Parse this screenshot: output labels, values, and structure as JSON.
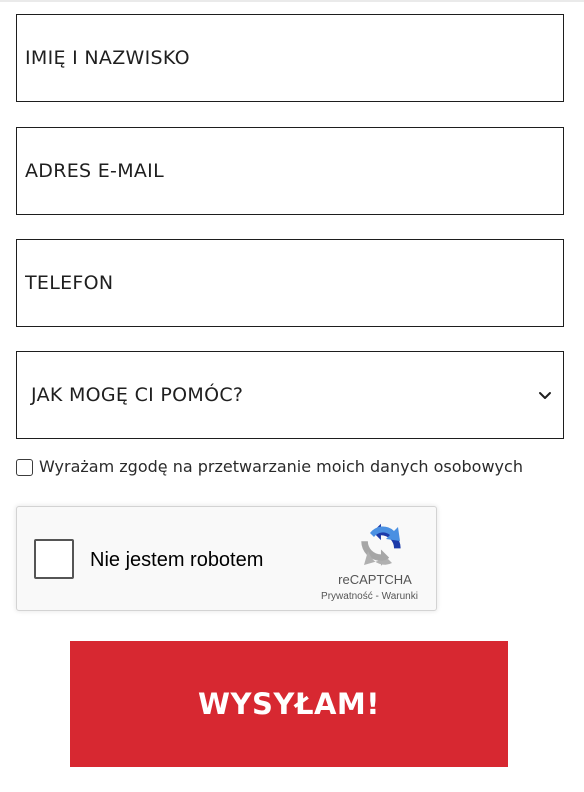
{
  "form": {
    "name_placeholder": "IMIĘ I NAZWISKO",
    "email_placeholder": "ADRES E-MAIL",
    "phone_placeholder": "TELEFON",
    "select_value": "JAK MOGĘ CI POMÓC?",
    "consent_label": "Wyrażam zgodę na przetwarzanie moich danych osobowych",
    "submit_label": "WYSYŁAM!"
  },
  "recaptcha": {
    "label": "Nie jestem robotem",
    "brand": "reCAPTCHA",
    "privacy_link": "Prywatność",
    "separator": " - ",
    "terms_link": "Warunki",
    "logo_icon": "recaptcha-logo-icon"
  },
  "colors": {
    "submit_background": "#d72831",
    "field_border": "#1e1e1e",
    "recaptcha_background": "#f9f9f9"
  }
}
